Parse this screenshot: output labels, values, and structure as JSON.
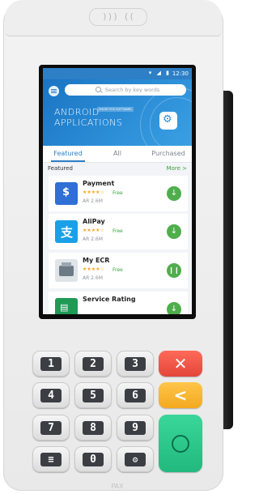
{
  "device": {
    "nfc_symbol": "))) ((",
    "bottom_logo": "PAX"
  },
  "status_bar": {
    "icons": "▾ ◢ ▮",
    "time": "12:30"
  },
  "search": {
    "placeholder": "Search by key words"
  },
  "banner": {
    "title_line1": "ANDROID",
    "title_line2": "APPLICATIONS",
    "tag": "SMART POS SOFTWARE"
  },
  "tabs": [
    {
      "label": "Featured",
      "active": true
    },
    {
      "label": "All",
      "active": false
    },
    {
      "label": "Purchased",
      "active": false
    }
  ],
  "section": {
    "title": "Featured",
    "more": "More >"
  },
  "apps": [
    {
      "name": "Payment",
      "stars": "★★★★☆",
      "price": "Free",
      "size": "AR 2.6M",
      "action": "↓",
      "icon_color": "#2f6fd6"
    },
    {
      "name": "AliPay",
      "stars": "★★★★☆",
      "price": "Free",
      "size": "AR 2.6M",
      "action": "↓",
      "icon_color": "#1aa0e8"
    },
    {
      "name": "My ECR",
      "stars": "★★★★☆",
      "price": "Free",
      "size": "AR 2.6M",
      "action": "❙❙",
      "icon_color": "#6c7a86"
    },
    {
      "name": "Service Rating",
      "stars": "",
      "price": "",
      "size": "",
      "action": "↓",
      "icon_color": "#1e9a55"
    }
  ],
  "keypad": {
    "k1": "1",
    "k2": "2",
    "k3": "3",
    "k4": "4",
    "k5": "5",
    "k6": "6",
    "k7": "7",
    "k8": "8",
    "k9": "9",
    "k0": "0",
    "cancel": "✕",
    "back": "<",
    "menu": "≡",
    "func": "⚙"
  },
  "colors": {
    "accent": "#2d7fc6",
    "green": "#4fae4c",
    "cancel_key": "#e3463a",
    "back_key": "#f3a91f",
    "enter_key": "#22b97d"
  }
}
